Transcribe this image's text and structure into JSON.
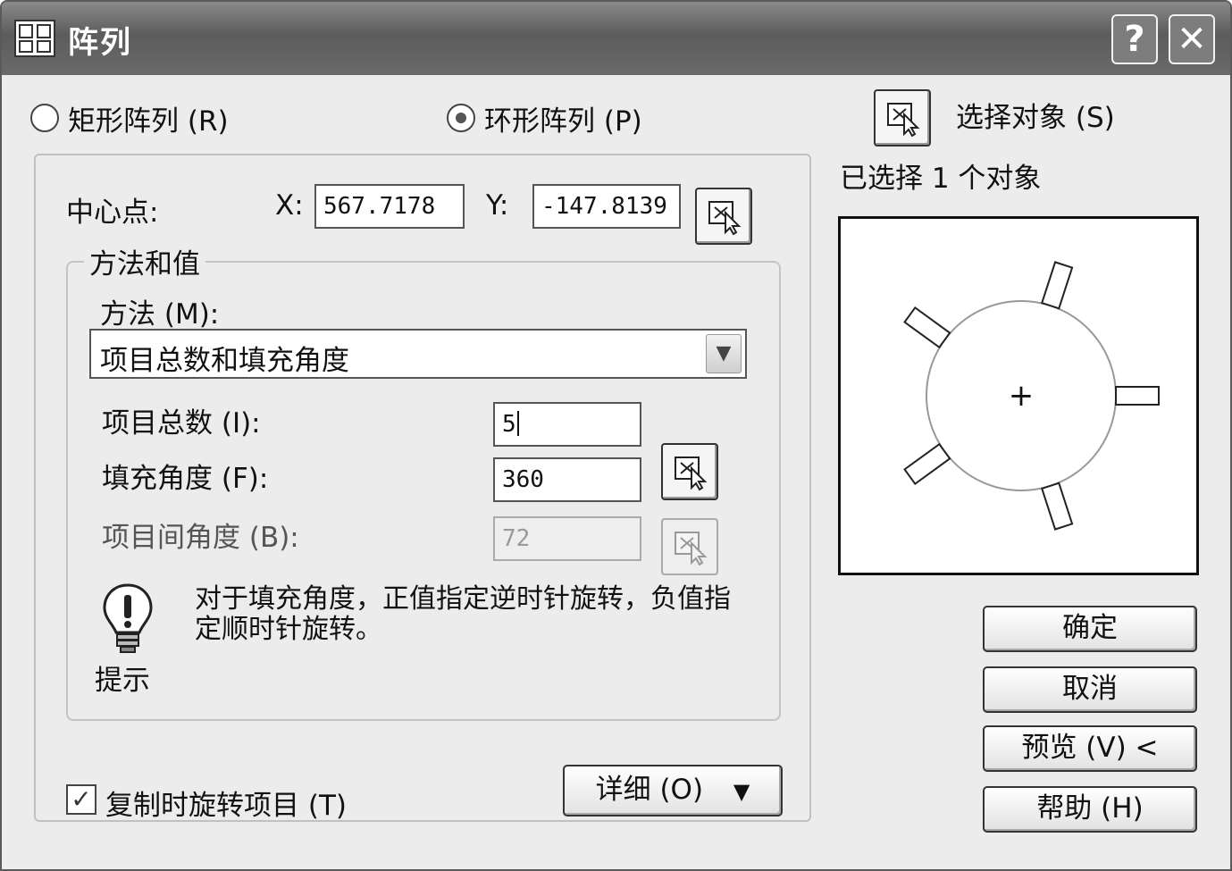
{
  "window": {
    "title": "阵列",
    "help_label": "?",
    "close_label": "✕"
  },
  "icons": {
    "app": "array-app-icon",
    "pick": "pick-point-icon",
    "tip": "lightbulb-icon"
  },
  "array_type": {
    "rectangular_label": "矩形阵列 (R)",
    "polar_label": "环形阵列 (P)",
    "selected": "polar"
  },
  "center_point": {
    "label": "中心点:",
    "x_label": "X:",
    "x_value": "567.7178",
    "y_label": "Y:",
    "y_value": "-147.8139"
  },
  "method_group": {
    "title": "方法和值",
    "method_label": "方法 (M):",
    "method_value": "项目总数和填充角度",
    "total_items_label": "项目总数 (I):",
    "total_items_value": "5",
    "fill_angle_label": "填充角度 (F):",
    "fill_angle_value": "360",
    "angle_between_label": "项目间角度 (B):",
    "angle_between_value": "72"
  },
  "tip": {
    "label": "提示",
    "text": "对于填充角度，正值指定逆时针旋转，负值指定顺时针旋转。"
  },
  "rotate_items": {
    "label": "复制时旋转项目 (T)",
    "checked": true,
    "check_glyph": "✓"
  },
  "details_button": {
    "label": "详细 (O)",
    "arrow": "▼"
  },
  "selection": {
    "button_label": "选择对象 (S)",
    "status": "已选择 1 个对象"
  },
  "buttons": {
    "ok": "确定",
    "cancel": "取消",
    "preview": "预览 (V) <",
    "help": "帮助 (H)"
  },
  "preview_diagram": {
    "item_count": 5,
    "fill_angle_deg": 360,
    "center_glyph": "+"
  }
}
